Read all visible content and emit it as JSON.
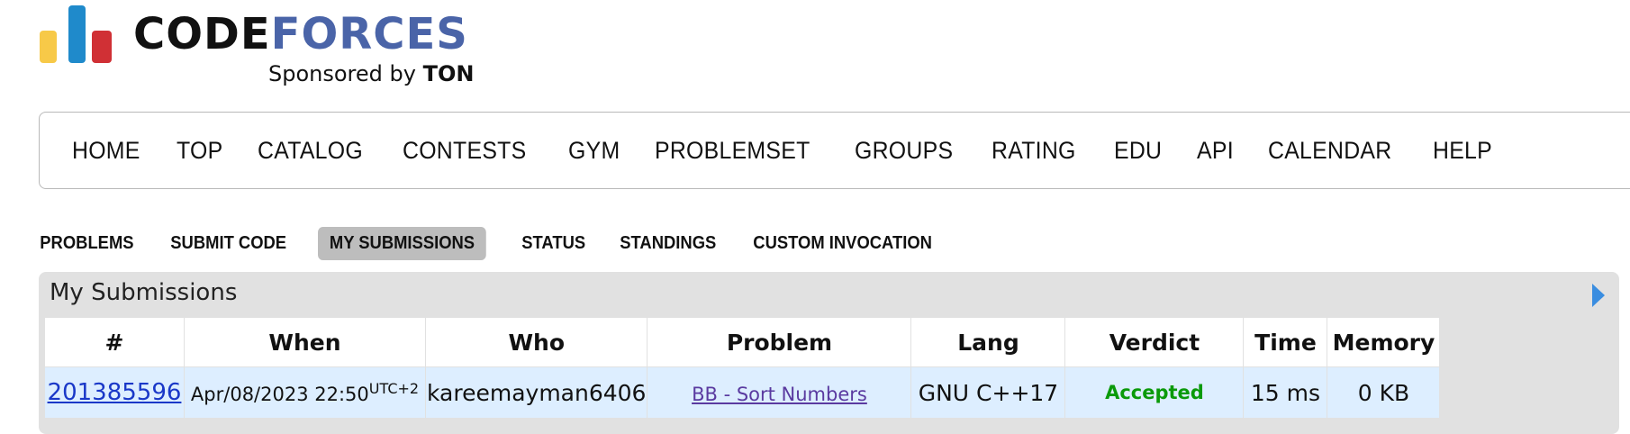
{
  "logo": {
    "word_code": "CODE",
    "word_forces": "FORCES",
    "sponsor_prefix": "Sponsored by",
    "sponsor_name": "TON",
    "colors": [
      "#f7c948",
      "#1f8acb",
      "#d03035"
    ]
  },
  "menu": {
    "items": [
      "HOME",
      "TOP",
      "CATALOG",
      "CONTESTS",
      "GYM",
      "PROBLEMSET",
      "GROUPS",
      "RATING",
      "EDU",
      "API",
      "CALENDAR",
      "HELP"
    ]
  },
  "subnav": {
    "items": [
      "PROBLEMS",
      "SUBMIT CODE",
      "MY SUBMISSIONS",
      "STATUS",
      "STANDINGS",
      "CUSTOM INVOCATION"
    ],
    "active": "MY SUBMISSIONS"
  },
  "submissions": {
    "title": "My Submissions",
    "columns": [
      "#",
      "When",
      "Who",
      "Problem",
      "Lang",
      "Verdict",
      "Time",
      "Memory"
    ],
    "rows": [
      {
        "id": "201385596",
        "when": "Apr/08/2023 22:50",
        "tz": "UTC+2",
        "who": "kareemayman6406",
        "problem": "BB - Sort Numbers",
        "lang": "GNU C++17",
        "verdict": "Accepted",
        "time": "15 ms",
        "memory": "0 KB"
      }
    ]
  },
  "colors": {
    "accent": "#4a64a8",
    "verdict_ok": "#0a9a0a",
    "row_bg": "#ddeeff"
  }
}
